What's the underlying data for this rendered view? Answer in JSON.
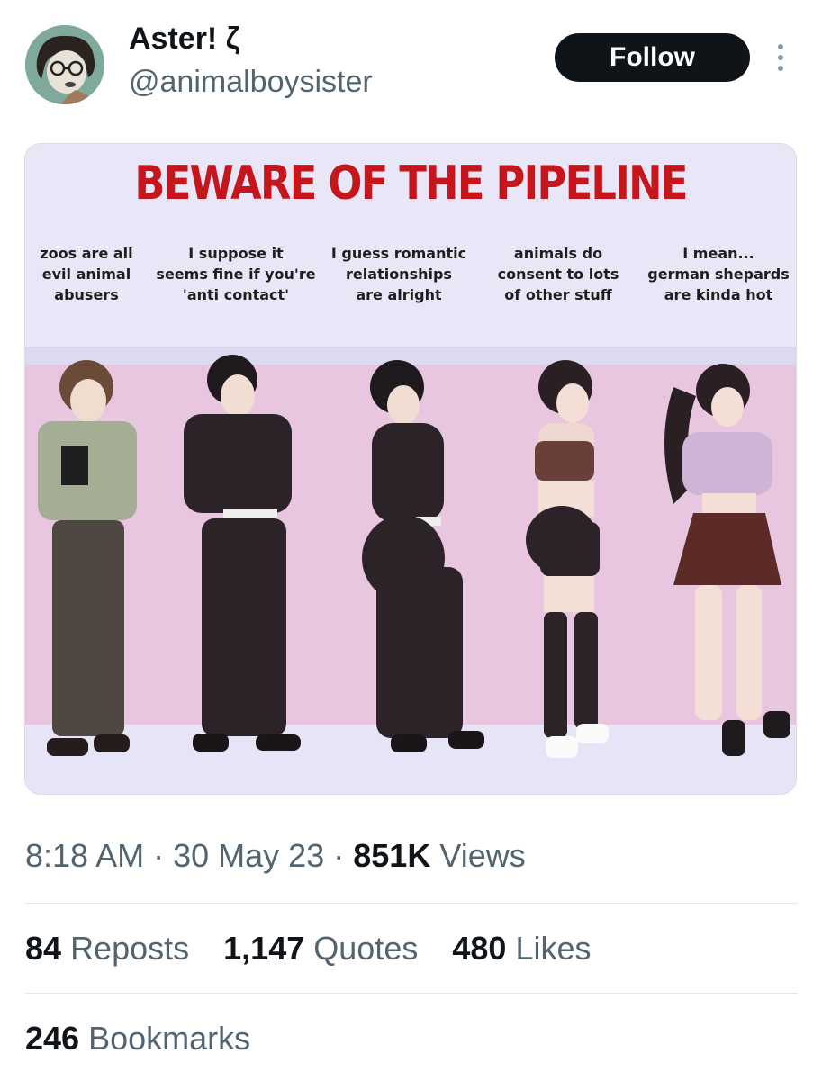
{
  "author": {
    "display_name": "Aster! ζ",
    "handle": "@animalboysister"
  },
  "follow_label": "Follow",
  "media": {
    "title": "BEWARE OF THE PIPELINE",
    "captions": [
      "zoos are all\nevil animal\nabusers",
      "I suppose it\nseems fine if you're\n'anti contact'",
      "I guess romantic\nrelationships\nare alright",
      "animals do\nconsent to lots\nof other stuff",
      "I mean...\ngerman shepards\nare kinda hot"
    ]
  },
  "meta": {
    "time": "8:18 AM",
    "separator": "·",
    "date": "30 May 23",
    "views_count": "851K",
    "views_label": "Views"
  },
  "stats": {
    "reposts_count": "84",
    "reposts_label": "Reposts",
    "quotes_count": "1,147",
    "quotes_label": "Quotes",
    "likes_count": "480",
    "likes_label": "Likes",
    "bookmarks_count": "246",
    "bookmarks_label": "Bookmarks"
  },
  "colors": {
    "title_red": "#c4161c",
    "panel_bg": "#e8e6f7",
    "wall_pink": "#e8c6df",
    "follow_bg": "#0f1419",
    "muted_text": "#536471"
  },
  "icons": [
    "more-vertical-icon"
  ]
}
